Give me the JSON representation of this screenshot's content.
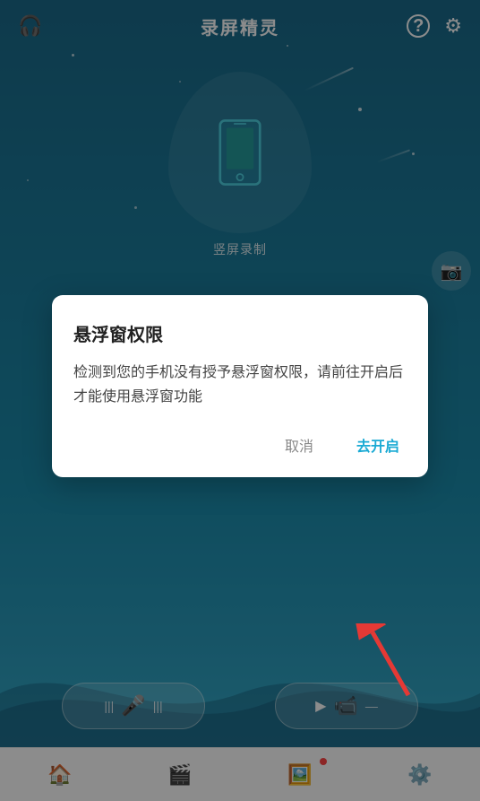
{
  "app": {
    "title": "录屏精灵"
  },
  "header": {
    "title": "录屏精灵",
    "help_icon": "?",
    "settings_icon": "⚙"
  },
  "phone_area": {
    "label": "竖屏录制"
  },
  "dialog": {
    "title": "悬浮窗权限",
    "body": "检测到您的手机没有授予悬浮窗权限，请前往开启后才能使用悬浮窗功能",
    "cancel_label": "取消",
    "confirm_label": "去开启"
  },
  "bottom_buttons": {
    "audio_label": "",
    "video_label": ""
  },
  "bottom_nav": {
    "home": "🏠",
    "film": "🎬",
    "album": "📷",
    "settings": "⚙"
  },
  "colors": {
    "bg_top": "#1a6a8a",
    "bg_bottom": "#3ab0cc",
    "dialog_confirm": "#1aaad4",
    "accent": "#1a90bb"
  }
}
